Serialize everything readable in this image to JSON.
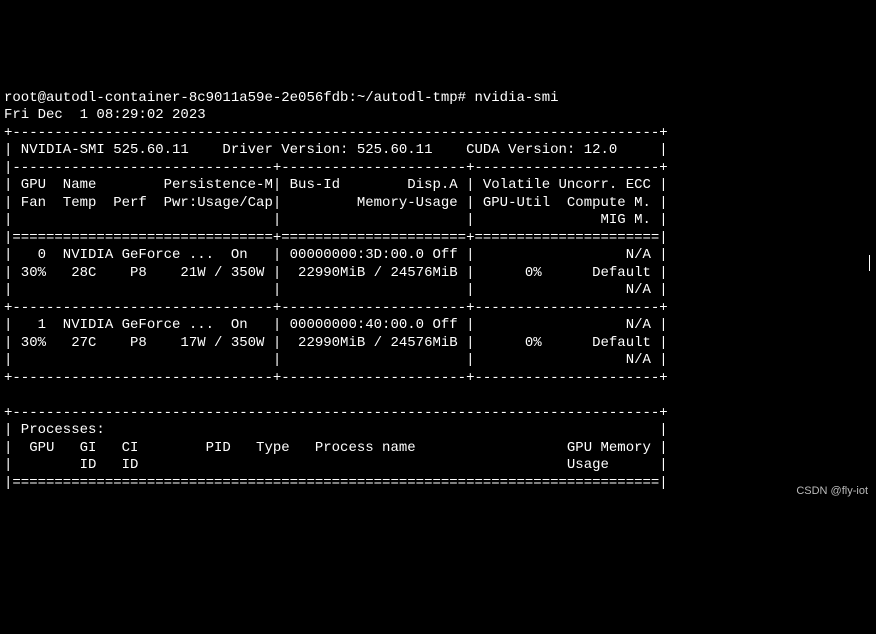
{
  "prompt_line": "root@autodl-container-8c9011a59e-2e056fdb:~/autodl-tmp# nvidia-smi",
  "timestamp_line": "Fri Dec  1 08:29:02 2023",
  "border_top": "+-----------------------------------------------------------------------------+",
  "header_versions": "| NVIDIA-SMI 525.60.11    Driver Version: 525.60.11    CUDA Version: 12.0     |",
  "section_sep": "|-------------------------------+----------------------+----------------------+",
  "hdr_row1": "| GPU  Name        Persistence-M| Bus-Id        Disp.A | Volatile Uncorr. ECC |",
  "hdr_row2": "| Fan  Temp  Perf  Pwr:Usage/Cap|         Memory-Usage | GPU-Util  Compute M. |",
  "hdr_row3": "|                               |                      |               MIG M. |",
  "double_sep": "|===============================+======================+======================|",
  "gpu0_row1": "|   0  NVIDIA GeForce ...  On   | 00000000:3D:00.0 Off |                  N/A |",
  "gpu0_row2": "| 30%   28C    P8    21W / 350W |  22990MiB / 24576MiB |      0%      Default |",
  "gpu0_row3": "|                               |                      |                  N/A |",
  "mid_sep": "+-------------------------------+----------------------+----------------------+",
  "gpu1_row1": "|   1  NVIDIA GeForce ...  On   | 00000000:40:00.0 Off |                  N/A |",
  "gpu1_row2": "| 30%   27C    P8    17W / 350W |  22990MiB / 24576MiB |      0%      Default |",
  "gpu1_row3": "|                               |                      |                  N/A |",
  "border_bottom": "+-------------------------------+----------------------+----------------------+",
  "blank": "                                                                               ",
  "proc_top": "+-----------------------------------------------------------------------------+",
  "proc_hdr": "| Processes:                                                                  |",
  "proc_cols1": "|  GPU   GI   CI        PID   Type   Process name                  GPU Memory |",
  "proc_cols2": "|        ID   ID                                                   Usage      |",
  "proc_sep": "|=============================================================================|",
  "watermark": "CSDN @fly-iot",
  "chart_data": {
    "type": "table",
    "title": "nvidia-smi",
    "driver_version": "525.60.11",
    "nvidia_smi_version": "525.60.11",
    "cuda_version": "12.0",
    "timestamp": "Fri Dec  1 08:29:02 2023",
    "gpus": [
      {
        "index": 0,
        "name": "NVIDIA GeForce ...",
        "persistence_m": "On",
        "bus_id": "00000000:3D:00.0",
        "disp_a": "Off",
        "ecc": "N/A",
        "fan_pct": 30,
        "temp_c": 28,
        "perf": "P8",
        "pwr_usage_w": 21,
        "pwr_cap_w": 350,
        "mem_used_mib": 22990,
        "mem_total_mib": 24576,
        "gpu_util_pct": 0,
        "compute_mode": "Default",
        "mig_mode": "N/A"
      },
      {
        "index": 1,
        "name": "NVIDIA GeForce ...",
        "persistence_m": "On",
        "bus_id": "00000000:40:00.0",
        "disp_a": "Off",
        "ecc": "N/A",
        "fan_pct": 30,
        "temp_c": 27,
        "perf": "P8",
        "pwr_usage_w": 17,
        "pwr_cap_w": 350,
        "mem_used_mib": 22990,
        "mem_total_mib": 24576,
        "gpu_util_pct": 0,
        "compute_mode": "Default",
        "mig_mode": "N/A"
      }
    ],
    "processes_columns": [
      "GPU",
      "GI ID",
      "CI ID",
      "PID",
      "Type",
      "Process name",
      "GPU Memory Usage"
    ],
    "processes": []
  }
}
